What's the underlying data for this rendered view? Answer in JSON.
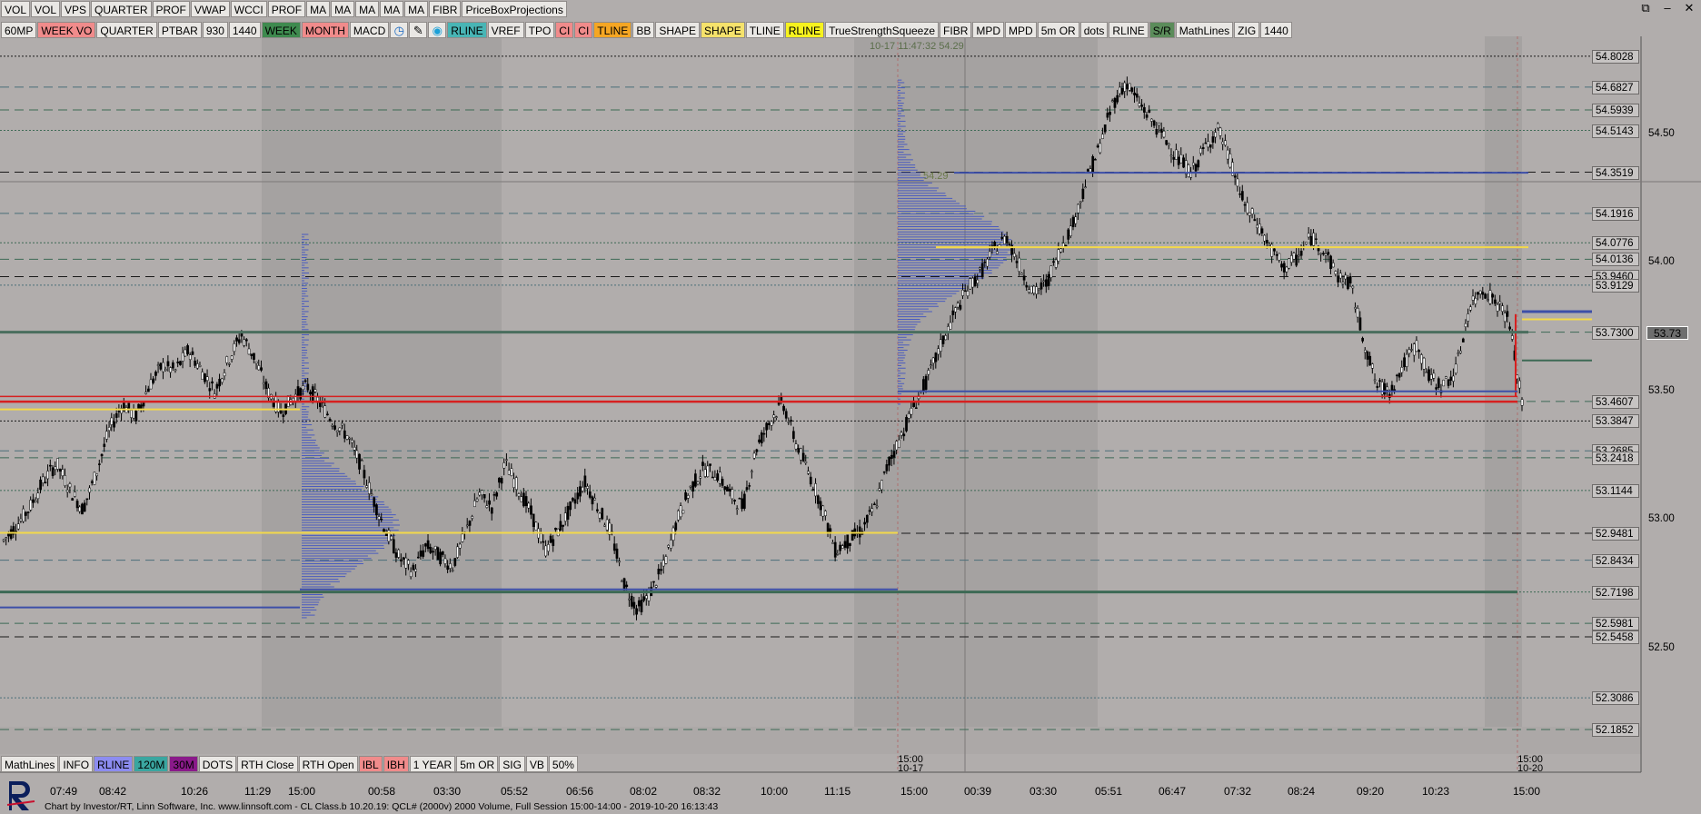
{
  "window_controls": [
    "⧉",
    "–",
    "✕"
  ],
  "toolbar_top": [
    {
      "label": "VOL",
      "bg": "#e9e7e4"
    },
    {
      "label": "VOL",
      "bg": "#e9e7e4"
    },
    {
      "label": "VPS",
      "bg": "#e9e7e4"
    },
    {
      "label": "QUARTER",
      "bg": "#e9e7e4"
    },
    {
      "label": "PROF",
      "bg": "#e9e7e4"
    },
    {
      "label": "VWAP",
      "bg": "#e9e7e4"
    },
    {
      "label": "WCCI",
      "bg": "#e9e7e4"
    },
    {
      "label": "PROF",
      "bg": "#e9e7e4"
    },
    {
      "label": "MA",
      "bg": "#e9e7e4"
    },
    {
      "label": "MA",
      "bg": "#e9e7e4"
    },
    {
      "label": "MA",
      "bg": "#e9e7e4"
    },
    {
      "label": "MA",
      "bg": "#e9e7e4"
    },
    {
      "label": "MA",
      "bg": "#e9e7e4"
    },
    {
      "label": "FIBR",
      "bg": "#e9e7e4"
    },
    {
      "label": "PriceBoxProjections",
      "bg": "#e9e7e4"
    }
  ],
  "toolbar_second": [
    {
      "label": "60MP",
      "bg": "#e9e7e4",
      "fg": "#000"
    },
    {
      "label": "WEEK VO",
      "bg": "#f08b8b",
      "fg": "#000"
    },
    {
      "label": "QUARTER",
      "bg": "#e9e7e4",
      "fg": "#000"
    },
    {
      "label": "PTBAR",
      "bg": "#e9e7e4",
      "fg": "#000"
    },
    {
      "label": "930",
      "bg": "#e9e7e4",
      "fg": "#000"
    },
    {
      "label": "1440",
      "bg": "#e9e7e4",
      "fg": "#000"
    },
    {
      "label": "WEEK",
      "bg": "#3e8a4e",
      "fg": "#000"
    },
    {
      "label": "MONTH",
      "bg": "#f08b8b",
      "fg": "#000"
    },
    {
      "label": "MACD",
      "bg": "#e9e7e4",
      "fg": "#000"
    },
    {
      "label": "◷",
      "bg": "#e9e7e4",
      "fg": "#1565c0",
      "icon": "clock-icon"
    },
    {
      "label": "✎",
      "bg": "#e9e7e4",
      "fg": "#000",
      "icon": "pencil-icon"
    },
    {
      "label": "◉",
      "bg": "#e9e7e4",
      "fg": "#1aa0d8",
      "icon": "target-icon"
    },
    {
      "label": "RLINE",
      "bg": "#48b5b5",
      "fg": "#000"
    },
    {
      "label": "VREF",
      "bg": "#e9e7e4",
      "fg": "#000"
    },
    {
      "label": "TPO",
      "bg": "#e9e7e4",
      "fg": "#000"
    },
    {
      "label": "CI",
      "bg": "#f08b8b",
      "fg": "#000"
    },
    {
      "label": "CI",
      "bg": "#f08b8b",
      "fg": "#000"
    },
    {
      "label": "TLINE",
      "bg": "#f5a623",
      "fg": "#000"
    },
    {
      "label": "BB",
      "bg": "#e9e7e4",
      "fg": "#000"
    },
    {
      "label": "SHAPE",
      "bg": "#e9e7e4",
      "fg": "#000"
    },
    {
      "label": "SHAPE",
      "bg": "#f5e26b",
      "fg": "#000"
    },
    {
      "label": "TLINE",
      "bg": "#e9e7e4",
      "fg": "#000"
    },
    {
      "label": "RLINE",
      "bg": "#f6f21e",
      "fg": "#000"
    },
    {
      "label": "TrueStrengthSqueeze",
      "bg": "#e9e7e4",
      "fg": "#000"
    },
    {
      "label": "FIBR",
      "bg": "#e9e7e4",
      "fg": "#000"
    },
    {
      "label": "MPD",
      "bg": "#e9e7e4",
      "fg": "#000"
    },
    {
      "label": "MPD",
      "bg": "#e9e7e4",
      "fg": "#000"
    },
    {
      "label": "5m OR",
      "bg": "#e9e7e4",
      "fg": "#000"
    },
    {
      "label": "dots",
      "bg": "#e9e7e4",
      "fg": "#000"
    },
    {
      "label": "RLINE",
      "bg": "#e9e7e4",
      "fg": "#000"
    },
    {
      "label": "S/R",
      "bg": "#5b8c5a",
      "fg": "#000"
    },
    {
      "label": "MathLines",
      "bg": "#e9e7e4",
      "fg": "#000"
    },
    {
      "label": "ZIG",
      "bg": "#e9e7e4",
      "fg": "#000"
    },
    {
      "label": "1440",
      "bg": "#e9e7e4",
      "fg": "#000"
    }
  ],
  "toolbar_bottom": [
    {
      "label": "MathLines",
      "bg": "#e9e7e4"
    },
    {
      "label": "INFO",
      "bg": "#e9e7e4"
    },
    {
      "label": "RLINE",
      "bg": "#8c8cf0"
    },
    {
      "label": "120M",
      "bg": "#3aa6a0"
    },
    {
      "label": "30M",
      "bg": "#8a1a8a"
    },
    {
      "label": "DOTS",
      "bg": "#e9e7e4"
    },
    {
      "label": "RTH Close",
      "bg": "#e9e7e4"
    },
    {
      "label": "RTH Open",
      "bg": "#e9e7e4"
    },
    {
      "label": "IBL",
      "bg": "#f08b8b"
    },
    {
      "label": "IBH",
      "bg": "#f08b8b"
    },
    {
      "label": "1 YEAR",
      "bg": "#e9e7e4"
    },
    {
      "label": "5m OR",
      "bg": "#e9e7e4"
    },
    {
      "label": "SIG",
      "bg": "#e9e7e4"
    },
    {
      "label": "VB",
      "bg": "#e9e7e4"
    },
    {
      "label": "50%",
      "bg": "#e9e7e4"
    }
  ],
  "top_info": "10-17 11:47:32 54.29",
  "profile_label": "54.29",
  "price_boxes": [
    "54.8028",
    "54.6827",
    "54.5939",
    "54.5143",
    "54.3519",
    "54.1916",
    "54.0776",
    "54.0136",
    "53.9460",
    "53.9129",
    "53.7300",
    "53.4607",
    "53.3847",
    "53.2685",
    "53.2418",
    "53.1144",
    "52.9481",
    "52.8434",
    "52.7198",
    "52.5981",
    "52.5458",
    "52.3086",
    "52.1852"
  ],
  "axis_labels": [
    "54.50",
    "54.00",
    "53.50",
    "53.00",
    "52.50"
  ],
  "current_price": "53.73",
  "time_labels": [
    "07:49",
    "08:42",
    "10:26",
    "11:29",
    "15:00",
    "00:58",
    "03:30",
    "05:52",
    "06:56",
    "08:02",
    "08:32",
    "10:00",
    "11:15",
    "15:00",
    "00:39",
    "03:30",
    "05:51",
    "06:47",
    "07:32",
    "08:24",
    "09:20",
    "10:23",
    "15:00"
  ],
  "session_labels": [
    {
      "time": "15:00",
      "date": "10-17"
    },
    {
      "time": "15:00",
      "date": "10-20"
    }
  ],
  "footer": "Chart by Investor/RT, Linn Software, Inc. www.linnsoft.com - CL Class.b   10.20.19: QCL# (2000v) 2000 Volume, Full Session 15:00-14:00 - 2019-10-20 16:13:43",
  "chart_data": {
    "type": "candlestick",
    "instrument": "QCL#",
    "ylim": [
      52.09,
      54.88
    ],
    "price_levels": [
      54.8028,
      54.6827,
      54.5939,
      54.5143,
      54.3519,
      54.1916,
      54.0776,
      54.0136,
      53.946,
      53.9129,
      53.73,
      53.4607,
      53.3847,
      53.2685,
      53.2418,
      53.1144,
      52.9481,
      52.8434,
      52.7198,
      52.5981,
      52.5458,
      52.3086,
      52.1852
    ],
    "last_price": 53.73,
    "close_path": [
      52.92,
      52.98,
      53.05,
      53.15,
      53.22,
      53.12,
      53.04,
      53.18,
      53.35,
      53.45,
      53.4,
      53.52,
      53.6,
      53.58,
      53.66,
      53.58,
      53.5,
      53.62,
      53.72,
      53.63,
      53.5,
      53.42,
      53.48,
      53.52,
      53.45,
      53.38,
      53.33,
      53.22,
      53.08,
      52.95,
      52.85,
      52.8,
      52.9,
      52.86,
      52.82,
      52.95,
      53.1,
      53.05,
      53.22,
      53.12,
      53.02,
      52.88,
      52.96,
      53.05,
      53.15,
      53.05,
      52.95,
      52.75,
      52.65,
      52.72,
      52.82,
      53.0,
      53.12,
      53.2,
      53.18,
      53.1,
      53.05,
      53.28,
      53.38,
      53.46,
      53.3,
      53.18,
      53.05,
      52.88,
      52.92,
      52.96,
      53.05,
      53.22,
      53.33,
      53.45,
      53.55,
      53.68,
      53.8,
      53.9,
      53.96,
      54.05,
      54.1,
      53.98,
      53.88,
      53.92,
      54.05,
      54.15,
      54.32,
      54.45,
      54.62,
      54.7,
      54.62,
      54.55,
      54.48,
      54.4,
      54.35,
      54.45,
      54.52,
      54.38,
      54.22,
      54.15,
      54.05,
      53.98,
      54.02,
      54.1,
      54.05,
      53.95,
      53.92,
      53.7,
      53.52,
      53.5,
      53.6,
      53.68,
      53.55,
      53.52,
      53.58,
      53.82,
      53.9,
      53.85,
      53.78,
      53.45
    ]
  }
}
